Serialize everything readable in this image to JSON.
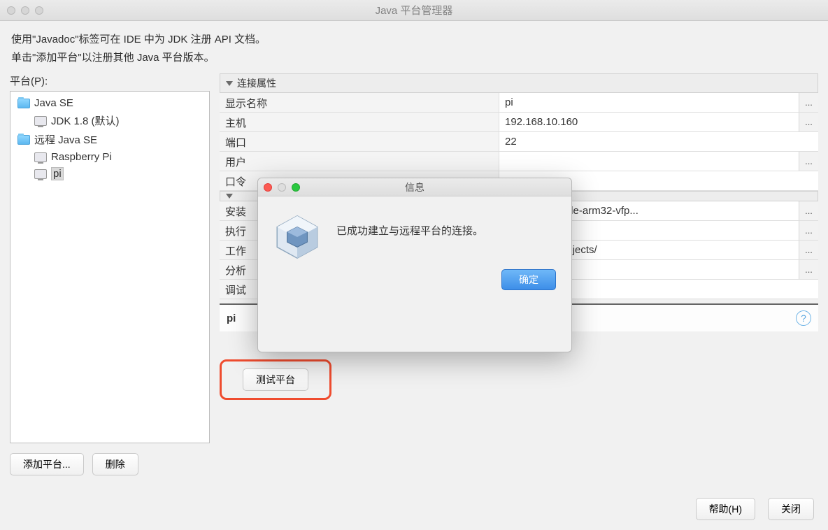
{
  "window": {
    "title": "Java 平台管理器"
  },
  "description": {
    "line1": "使用\"Javadoc\"标签可在 IDE 中为 JDK 注册 API 文档。",
    "line2": "单击\"添加平台\"以注册其他 Java 平台版本。"
  },
  "left": {
    "label": "平台(P):",
    "tree": {
      "javase": "Java SE",
      "jdk18": "JDK 1.8 (默认)",
      "remote": "远程 Java SE",
      "rpi": "Raspberry Pi",
      "pi": "pi"
    },
    "addBtn": "添加平台...",
    "deleteBtn": "删除"
  },
  "right": {
    "section1": "连接属性",
    "rows": {
      "displayName": {
        "label": "显示名称",
        "value": "pi"
      },
      "host": {
        "label": "主机",
        "value": "192.168.10.160"
      },
      "port": {
        "label": "端口",
        "value": "22"
      },
      "user": {
        "label": "用户",
        "value": ""
      },
      "password": {
        "label": "口令",
        "value": ""
      }
    },
    "section2": "",
    "rows2": {
      "install": {
        "label": "安装",
        "value": "jvm/jdk-8-oracle-arm32-vfp..."
      },
      "exec": {
        "label": "执行",
        "value": ""
      },
      "work": {
        "label": "工作",
        "value": "i/NetBeansProjects/"
      },
      "analyze": {
        "label": "分析",
        "value": ""
      },
      "debug": {
        "label": "调试",
        "value": ""
      }
    },
    "piLabel": "pi",
    "testBtn": "测试平台"
  },
  "footer": {
    "help": "帮助(H)",
    "close": "关闭"
  },
  "dialog": {
    "title": "信息",
    "message": "已成功建立与远程平台的连接。",
    "ok": "确定"
  },
  "ellipsis": "..."
}
